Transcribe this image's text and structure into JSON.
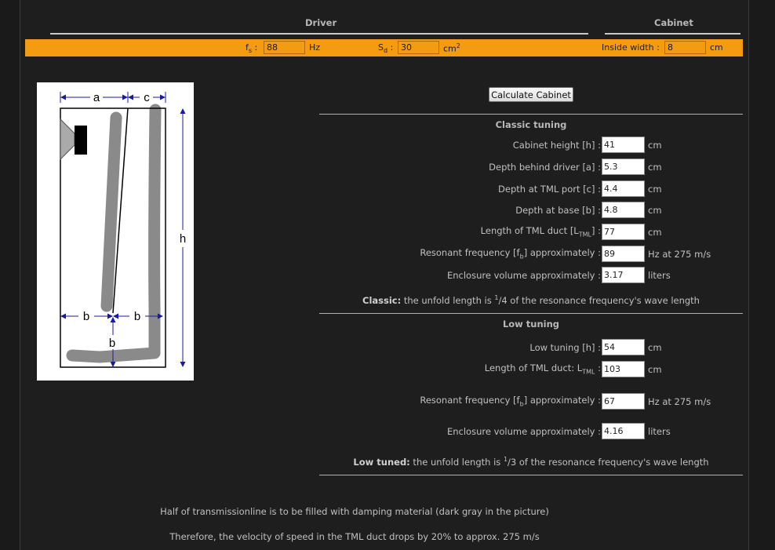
{
  "headers": {
    "driver": "Driver",
    "cabinet": "Cabinet"
  },
  "inputs_band": {
    "fs": {
      "label": "f",
      "sub": "s",
      "colon": ":",
      "value": "88",
      "unit": "Hz"
    },
    "sd": {
      "label": "S",
      "sub": "d",
      "colon": ":",
      "value": "30",
      "unit": "cm",
      "unit_sup": "2"
    },
    "width": {
      "label": "Inside width :",
      "value": "8",
      "unit": "cm"
    }
  },
  "diagram_labels": {
    "a": "a",
    "c": "c",
    "h": "h",
    "b": "b"
  },
  "calc_button": "Calculate Cabinet",
  "classic": {
    "title": "Classic tuning",
    "rows": [
      {
        "label": "Cabinet height [h] :",
        "value": "41",
        "unit": "cm"
      },
      {
        "label": "Depth behind driver [a] :",
        "value": "5.3",
        "unit": "cm"
      },
      {
        "label": "Depth at TML port [c] :",
        "value": "4.4",
        "unit": "cm"
      },
      {
        "label": "Depth at base [b] :",
        "value": "4.8",
        "unit": "cm"
      },
      {
        "label_pre": "Length of TML duct [L",
        "label_sub": "TML",
        "label_post": "] :",
        "value": "77",
        "unit": "cm"
      },
      {
        "label_pre": "Resonant frequency [f",
        "label_sub": "b",
        "label_post": "] approximately :",
        "value": "89",
        "unit": "Hz at 275 m/s"
      },
      {
        "label": "Enclosure volume approximately :",
        "value": "3.17",
        "unit": "liters"
      }
    ],
    "note_bold": "Classic:",
    "note_pre": " the unfold length is ",
    "note_num": "1",
    "note_den": "/4",
    "note_post": " of the resonance frequency's wave length"
  },
  "low": {
    "title": "Low tuning",
    "rows": [
      {
        "label": "Low tuning [h] :",
        "value": "54",
        "unit": "cm"
      },
      {
        "label_pre": "Length of TML duct: L",
        "label_sub": "TML",
        "label_post": " :",
        "value": "103",
        "unit": "cm"
      },
      {
        "label_pre": "Resonant frequency [f",
        "label_sub": "b",
        "label_post": "] approximately :",
        "value": "67",
        "unit": "Hz at 275 m/s"
      },
      {
        "label": "Enclosure volume approximately :",
        "value": "4.16",
        "unit": "liters"
      }
    ],
    "note_bold": "Low tuned:",
    "note_pre": " the unfold length is ",
    "note_num": "1",
    "note_den": "/3",
    "note_post": " of the resonance frequency's wave length"
  },
  "footer": {
    "line1": "Half of transmissionline is to be filled with damping material (dark gray in the picture)",
    "line2": "Therefore, the velocity of speed in the TML duct drops by 20% to approx. 275 m/s"
  },
  "colors": {
    "accent": "#f39c12",
    "background": "#1e1e1e",
    "diagram_arrows": "#1a1aa0",
    "damping": "#888888"
  }
}
